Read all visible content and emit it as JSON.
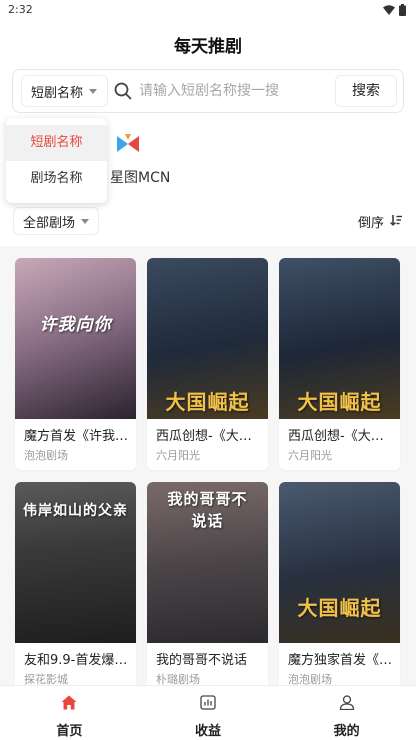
{
  "status_bar": {
    "time": "2:32"
  },
  "header": {
    "title": "每天推剧"
  },
  "search": {
    "type_selected": "短剧名称",
    "placeholder": "请输入短剧名称搜一搜",
    "value": "",
    "button_label": "搜索"
  },
  "type_dropdown": {
    "options": [
      {
        "label": "短剧名称",
        "selected": true
      },
      {
        "label": "剧场名称",
        "selected": false
      }
    ]
  },
  "banner": {
    "text": "星图MCN",
    "logo_colors": [
      "#e8473f",
      "#3aa7e8",
      "#f29b30"
    ]
  },
  "filter": {
    "theater_selected": "全部剧场",
    "sort_label": "倒序"
  },
  "dramas": [
    {
      "title": "魔方首发《许我…",
      "source": "泡泡剧场",
      "poster_text": "许我向你"
    },
    {
      "title": "西瓜创想-《大…",
      "source": "六月阳光",
      "poster_text": "大国崛起"
    },
    {
      "title": "西瓜创想-《大…",
      "source": "六月阳光",
      "poster_text": "大国崛起"
    },
    {
      "title": "友和9.9-首发爆…",
      "source": "探花影城",
      "poster_text": "伟岸如山的父亲"
    },
    {
      "title": "我的哥哥不说话",
      "source": "朴璐剧场",
      "poster_text": "我的哥哥不说话"
    },
    {
      "title": "魔方独家首发《…",
      "source": "泡泡剧场",
      "poster_text": "大国崛起"
    }
  ],
  "bottom_nav": {
    "items": [
      {
        "label": "首页",
        "icon": "home-icon",
        "active": true,
        "color": "#e8473f"
      },
      {
        "label": "收益",
        "icon": "earnings-icon",
        "active": false
      },
      {
        "label": "我的",
        "icon": "profile-icon",
        "active": false
      }
    ]
  }
}
